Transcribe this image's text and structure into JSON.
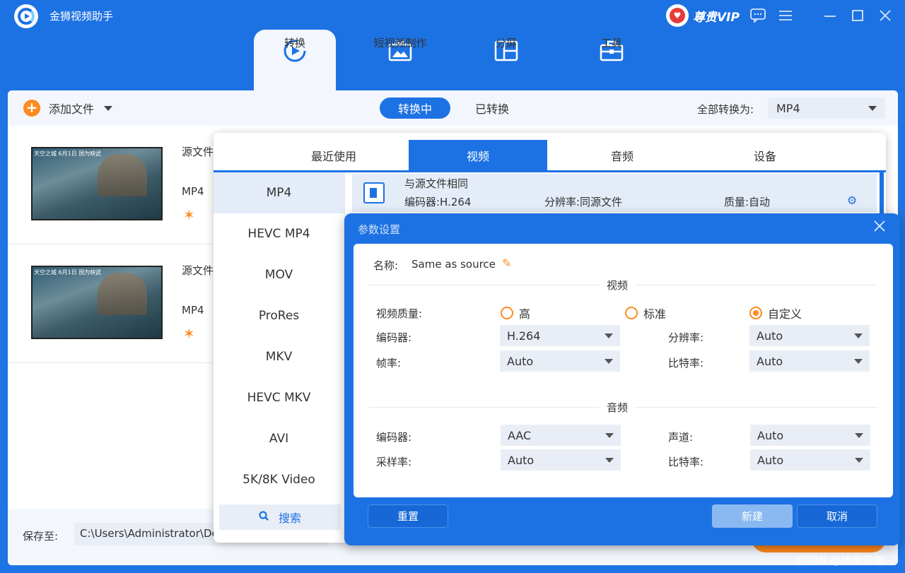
{
  "app": {
    "title": "金狮视频助手",
    "vip_label": "尊贵VIP"
  },
  "main_tabs": [
    {
      "label": "转换",
      "icon": "convert-icon",
      "active": true
    },
    {
      "label": "短视频制作",
      "icon": "tv-icon"
    },
    {
      "label": "分屏",
      "icon": "split-screen-icon"
    },
    {
      "label": "工具",
      "icon": "toolbox-icon"
    }
  ],
  "toolbar": {
    "add_file": "添加文件",
    "segment_active": "转换中",
    "segment_other": "已转换",
    "convert_all_label": "全部转换为:",
    "convert_all_value": "MP4"
  },
  "files": [
    {
      "source_label": "源文件",
      "format": "MP4",
      "thumb_caption": "天空之城  6月1日 国为映武"
    },
    {
      "source_label": "源文件",
      "format": "MP4",
      "thumb_caption": "天空之城  6月1日 国为映武"
    }
  ],
  "bottom": {
    "save_label": "保存至:",
    "save_path": "C:\\Users\\Administrator\\Desktop"
  },
  "format_panel": {
    "tabs": [
      "最近使用",
      "视频",
      "音频",
      "设备"
    ],
    "active_tab": 1,
    "formats": [
      "MP4",
      "HEVC MP4",
      "MOV",
      "ProRes",
      "MKV",
      "HEVC MKV",
      "AVI",
      "5K/8K Video"
    ],
    "search_label": "搜索",
    "preset": {
      "title": "与源文件相同",
      "encoder": "编码器:H.264",
      "resolution": "分辨率:同源文件",
      "quality": "质量:自动"
    }
  },
  "dialog": {
    "title": "参数设置",
    "name_label": "名称:",
    "name_value": "Same as source",
    "video_section": "视频",
    "video_quality_label": "视频质量:",
    "quality_options": [
      "高",
      "标准",
      "自定义"
    ],
    "quality_selected": 2,
    "video_encoder_label": "编码器:",
    "video_encoder_value": "H.264",
    "resolution_label": "分辨率:",
    "resolution_value": "Auto",
    "framerate_label": "帧率:",
    "framerate_value": "Auto",
    "video_bitrate_label": "比特率:",
    "video_bitrate_value": "Auto",
    "audio_section": "音频",
    "audio_encoder_label": "编码器:",
    "audio_encoder_value": "AAC",
    "channel_label": "声道:",
    "channel_value": "Auto",
    "samplerate_label": "采样率:",
    "samplerate_value": "Auto",
    "audio_bitrate_label": "比特率:",
    "audio_bitrate_value": "Auto",
    "reset_button": "重置",
    "new_button": "新建",
    "cancel_button": "取消"
  },
  "watermark": "CSDN @沐禾安信",
  "colors": {
    "primary": "#1d72e3",
    "accent": "#ff8a1e"
  }
}
